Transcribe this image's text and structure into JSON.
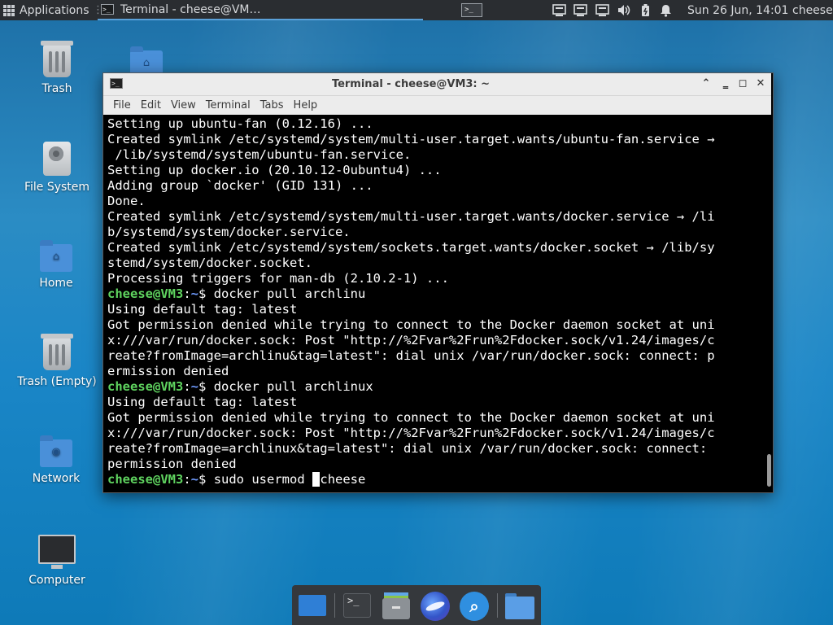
{
  "top_panel": {
    "applications_label": "Applications",
    "task_title": "Terminal - cheese@VM…",
    "workspace_glyph": ">_",
    "clock": "Sun 26 Jun, 14:01",
    "user": "cheese",
    "tray_icons": [
      "display-icon",
      "display-icon",
      "display-icon",
      "volume-icon",
      "battery-icon",
      "notification-bell-icon"
    ]
  },
  "desktop_icons": [
    {
      "name": "trash",
      "label": "Trash",
      "icon": "trash-icon"
    },
    {
      "name": "file-system",
      "label": "File System",
      "icon": "drive-icon"
    },
    {
      "name": "home",
      "label": "Home",
      "icon": "home-folder-icon"
    },
    {
      "name": "trash-empty",
      "label": "Trash (Empty)",
      "icon": "trash-icon"
    },
    {
      "name": "network",
      "label": "Network",
      "icon": "network-folder-icon"
    },
    {
      "name": "computer",
      "label": "Computer",
      "icon": "monitor-icon"
    }
  ],
  "terminal": {
    "title": "Terminal - cheese@VM3: ~",
    "title_icon": ">_",
    "window_buttons": {
      "shade": "⌃",
      "minimize": "‗",
      "maximize": "◻",
      "close": "✕"
    },
    "menu": [
      "File",
      "Edit",
      "View",
      "Terminal",
      "Tabs",
      "Help"
    ],
    "prompt_user": "cheese@VM3",
    "prompt_sep": ":",
    "prompt_path": "~",
    "prompt_end": "$",
    "lines": [
      "Setting up ubuntu-fan (0.12.16) ...",
      "Created symlink /etc/systemd/system/multi-user.target.wants/ubuntu-fan.service →",
      " /lib/systemd/system/ubuntu-fan.service.",
      "Setting up docker.io (20.10.12-0ubuntu4) ...",
      "Adding group `docker' (GID 131) ...",
      "Done.",
      "Created symlink /etc/systemd/system/multi-user.target.wants/docker.service → /li",
      "b/systemd/system/docker.service.",
      "Created symlink /etc/systemd/system/sockets.target.wants/docker.socket → /lib/sy",
      "stemd/system/docker.socket.",
      "Processing triggers for man-db (2.10.2-1) ..."
    ],
    "command_1": " docker pull archlinu",
    "output_1": [
      "Using default tag: latest",
      "Got permission denied while trying to connect to the Docker daemon socket at uni",
      "x:///var/run/docker.sock: Post \"http://%2Fvar%2Frun%2Fdocker.sock/v1.24/images/c",
      "reate?fromImage=archlinu&tag=latest\": dial unix /var/run/docker.sock: connect: p",
      "ermission denied"
    ],
    "command_2": " docker pull archlinux",
    "output_2": [
      "Using default tag: latest",
      "Got permission denied while trying to connect to the Docker daemon socket at uni",
      "x:///var/run/docker.sock: Post \"http://%2Fvar%2Frun%2Fdocker.sock/v1.24/images/c",
      "reate?fromImage=archlinux&tag=latest\": dial unix /var/run/docker.sock: connect:",
      "permission denied"
    ],
    "current_input_before_cursor": " sudo usermod ",
    "cursor_char": " ",
    "current_input_after_cursor": "cheese"
  },
  "dock": {
    "items": [
      "show-desktop-icon",
      "terminal-icon",
      "file-manager-icon",
      "web-browser-icon",
      "app-finder-icon",
      "folder-icon"
    ],
    "terminal_glyph": ">_",
    "search_glyph": "⌕"
  },
  "colors": {
    "prompt_user": "#5fd35f",
    "prompt_path": "#6f9bff",
    "terminal_bg": "#000000",
    "desktop_bg": "#1a86c7"
  }
}
